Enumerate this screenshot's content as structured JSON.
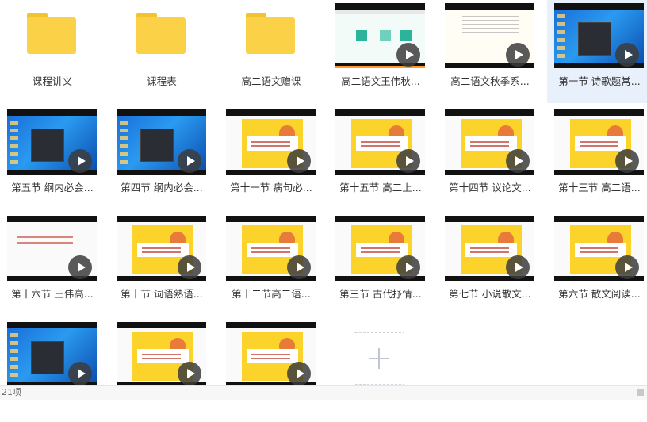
{
  "folders": [
    {
      "label": "课程讲义"
    },
    {
      "label": "课程表"
    },
    {
      "label": "高二语文赠课"
    }
  ],
  "videos": [
    {
      "label": "高二语文王伟秋...",
      "thumb": "diagram"
    },
    {
      "label": "高二语文秋季系...",
      "thumb": "doc"
    },
    {
      "label": "第一节 诗歌题常...",
      "thumb": "desktop",
      "selected": true
    },
    {
      "label": "第五节 纲内必会...",
      "thumb": "desktop"
    },
    {
      "label": "第四节 纲内必会...",
      "thumb": "desktop"
    },
    {
      "label": "第十一节 病句必...",
      "thumb": "yellow"
    },
    {
      "label": "第十五节 高二上...",
      "thumb": "yellow"
    },
    {
      "label": "第十四节 议论文...",
      "thumb": "yellow"
    },
    {
      "label": "第十三节 高二语...",
      "thumb": "yellow"
    },
    {
      "label": "第十六节 王伟高...",
      "thumb": "white"
    },
    {
      "label": "第十节 词语熟语...",
      "thumb": "yellow"
    },
    {
      "label": "第十二节高二语...",
      "thumb": "yellow"
    },
    {
      "label": "第三节 古代抒情...",
      "thumb": "yellow"
    },
    {
      "label": "第七节 小说散文...",
      "thumb": "yellow"
    },
    {
      "label": "第六节 散文阅读...",
      "thumb": "yellow"
    },
    {
      "label": "",
      "thumb": "desktop"
    },
    {
      "label": "",
      "thumb": "yellow"
    },
    {
      "label": "",
      "thumb": "yellow"
    }
  ],
  "new_item_icon": "plus-icon",
  "status": {
    "item_count": "21项"
  },
  "colors": {
    "folder": "#fbd147",
    "selected": "#e8f1fb",
    "slide_yellow": "#fbd32a"
  }
}
